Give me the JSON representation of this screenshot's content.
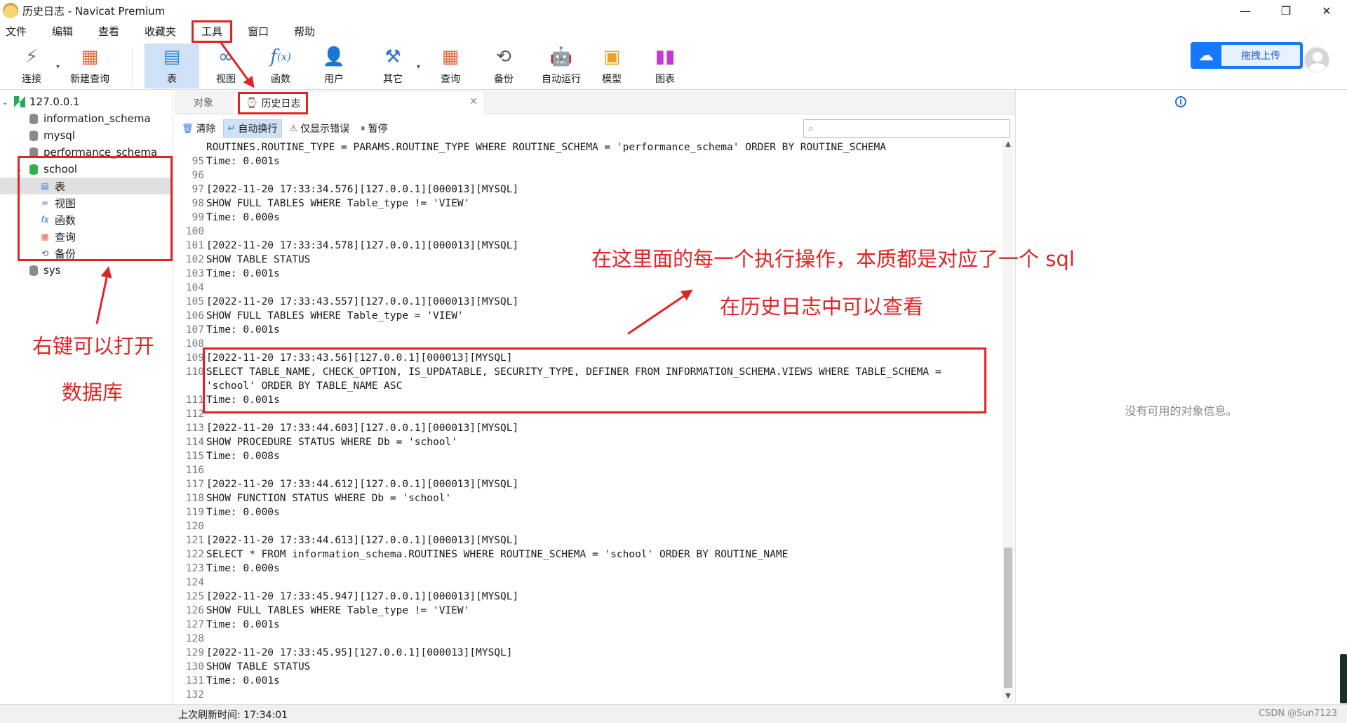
{
  "window": {
    "title": "历史日志 - Navicat Premium",
    "min": "—",
    "restore": "❐",
    "close": "✕"
  },
  "menu": [
    "文件",
    "编辑",
    "查看",
    "收藏夹",
    "工具",
    "窗口",
    "帮助"
  ],
  "toolbar": {
    "connect": "连接",
    "new_query": "新建查询",
    "table": "表",
    "view": "视图",
    "function": "函数",
    "user": "用户",
    "other": "其它",
    "query": "查询",
    "backup": "备份",
    "auto_run": "自动运行",
    "model": "模型",
    "chart": "图表",
    "baidu_upload": "拖拽上传"
  },
  "icons": {
    "connect": "plug-icon",
    "new_query": "new-query-icon",
    "table": "table-icon",
    "view": "view-icon",
    "function": "function-icon",
    "user": "user-icon",
    "other": "tools-icon",
    "query": "query-icon",
    "backup": "backup-icon",
    "auto_run": "robot-icon",
    "model": "model-icon",
    "chart": "chart-icon"
  },
  "tree": {
    "connection": "127.0.0.1",
    "databases": [
      "information_schema",
      "mysql",
      "performance_schema",
      "school",
      "sys"
    ],
    "school_children": [
      "表",
      "视图",
      "函数",
      "查询",
      "备份"
    ]
  },
  "tabs": {
    "objects": "对象",
    "history": "历史日志"
  },
  "logbar": {
    "clear": "清除",
    "wrap": "自动换行",
    "errors_only": "仅显示错误",
    "pause": "暂停",
    "search_placeholder": ""
  },
  "log_lines": [
    {
      "n": "",
      "t": "ROUTINES.ROUTINE_TYPE = PARAMS.ROUTINE_TYPE WHERE ROUTINE_SCHEMA = 'performance_schema' ORDER BY ROUTINE_SCHEMA"
    },
    {
      "n": "95",
      "t": "Time: 0.001s"
    },
    {
      "n": "96",
      "t": ""
    },
    {
      "n": "97",
      "t": "[2022-11-20 17:33:34.576][127.0.0.1][000013][MYSQL]"
    },
    {
      "n": "98",
      "t": "SHOW FULL TABLES WHERE Table_type != 'VIEW'"
    },
    {
      "n": "99",
      "t": "Time: 0.000s"
    },
    {
      "n": "100",
      "t": ""
    },
    {
      "n": "101",
      "t": "[2022-11-20 17:33:34.578][127.0.0.1][000013][MYSQL]"
    },
    {
      "n": "102",
      "t": "SHOW TABLE STATUS"
    },
    {
      "n": "103",
      "t": "Time: 0.001s"
    },
    {
      "n": "104",
      "t": ""
    },
    {
      "n": "105",
      "t": "[2022-11-20 17:33:43.557][127.0.0.1][000013][MYSQL]"
    },
    {
      "n": "106",
      "t": "SHOW FULL TABLES WHERE Table_type = 'VIEW'"
    },
    {
      "n": "107",
      "t": "Time: 0.001s"
    },
    {
      "n": "108",
      "t": ""
    },
    {
      "n": "109",
      "t": "[2022-11-20 17:33:43.56][127.0.0.1][000013][MYSQL]"
    },
    {
      "n": "110",
      "t": "SELECT TABLE_NAME, CHECK_OPTION, IS_UPDATABLE, SECURITY_TYPE, DEFINER FROM INFORMATION_SCHEMA.VIEWS WHERE TABLE_SCHEMA ="
    },
    {
      "n": "",
      "t": "'school' ORDER BY TABLE_NAME ASC"
    },
    {
      "n": "111",
      "t": "Time: 0.001s"
    },
    {
      "n": "112",
      "t": ""
    },
    {
      "n": "113",
      "t": "[2022-11-20 17:33:44.603][127.0.0.1][000013][MYSQL]"
    },
    {
      "n": "114",
      "t": "SHOW PROCEDURE STATUS WHERE Db = 'school'"
    },
    {
      "n": "115",
      "t": "Time: 0.008s"
    },
    {
      "n": "116",
      "t": ""
    },
    {
      "n": "117",
      "t": "[2022-11-20 17:33:44.612][127.0.0.1][000013][MYSQL]"
    },
    {
      "n": "118",
      "t": "SHOW FUNCTION STATUS WHERE Db = 'school'"
    },
    {
      "n": "119",
      "t": "Time: 0.000s"
    },
    {
      "n": "120",
      "t": ""
    },
    {
      "n": "121",
      "t": "[2022-11-20 17:33:44.613][127.0.0.1][000013][MYSQL]"
    },
    {
      "n": "122",
      "t": "SELECT * FROM information_schema.ROUTINES WHERE ROUTINE_SCHEMA = 'school' ORDER BY ROUTINE_NAME"
    },
    {
      "n": "123",
      "t": "Time: 0.000s"
    },
    {
      "n": "124",
      "t": ""
    },
    {
      "n": "125",
      "t": "[2022-11-20 17:33:45.947][127.0.0.1][000013][MYSQL]"
    },
    {
      "n": "126",
      "t": "SHOW FULL TABLES WHERE Table_type != 'VIEW'"
    },
    {
      "n": "127",
      "t": "Time: 0.001s"
    },
    {
      "n": "128",
      "t": ""
    },
    {
      "n": "129",
      "t": "[2022-11-20 17:33:45.95][127.0.0.1][000013][MYSQL]"
    },
    {
      "n": "130",
      "t": "SHOW TABLE STATUS"
    },
    {
      "n": "131",
      "t": "Time: 0.001s"
    },
    {
      "n": "132",
      "t": ""
    }
  ],
  "right_panel": {
    "empty": "没有可用的对象信息。"
  },
  "status": {
    "refresh_time": "上次刷新时间: 17:34:01",
    "watermark": "CSDN @Sun7123"
  },
  "annotations": {
    "main_note": "在这里面的每一个执行操作，本质都是对应了一个 sql",
    "sub_note": "在历史日志中可以查看",
    "left_note_1": "右键可以打开",
    "left_note_2": "数据库"
  },
  "colors": {
    "highlight_red": "#e02424",
    "active_blue": "#cfe1f7",
    "baidu_blue": "#1677ff"
  }
}
